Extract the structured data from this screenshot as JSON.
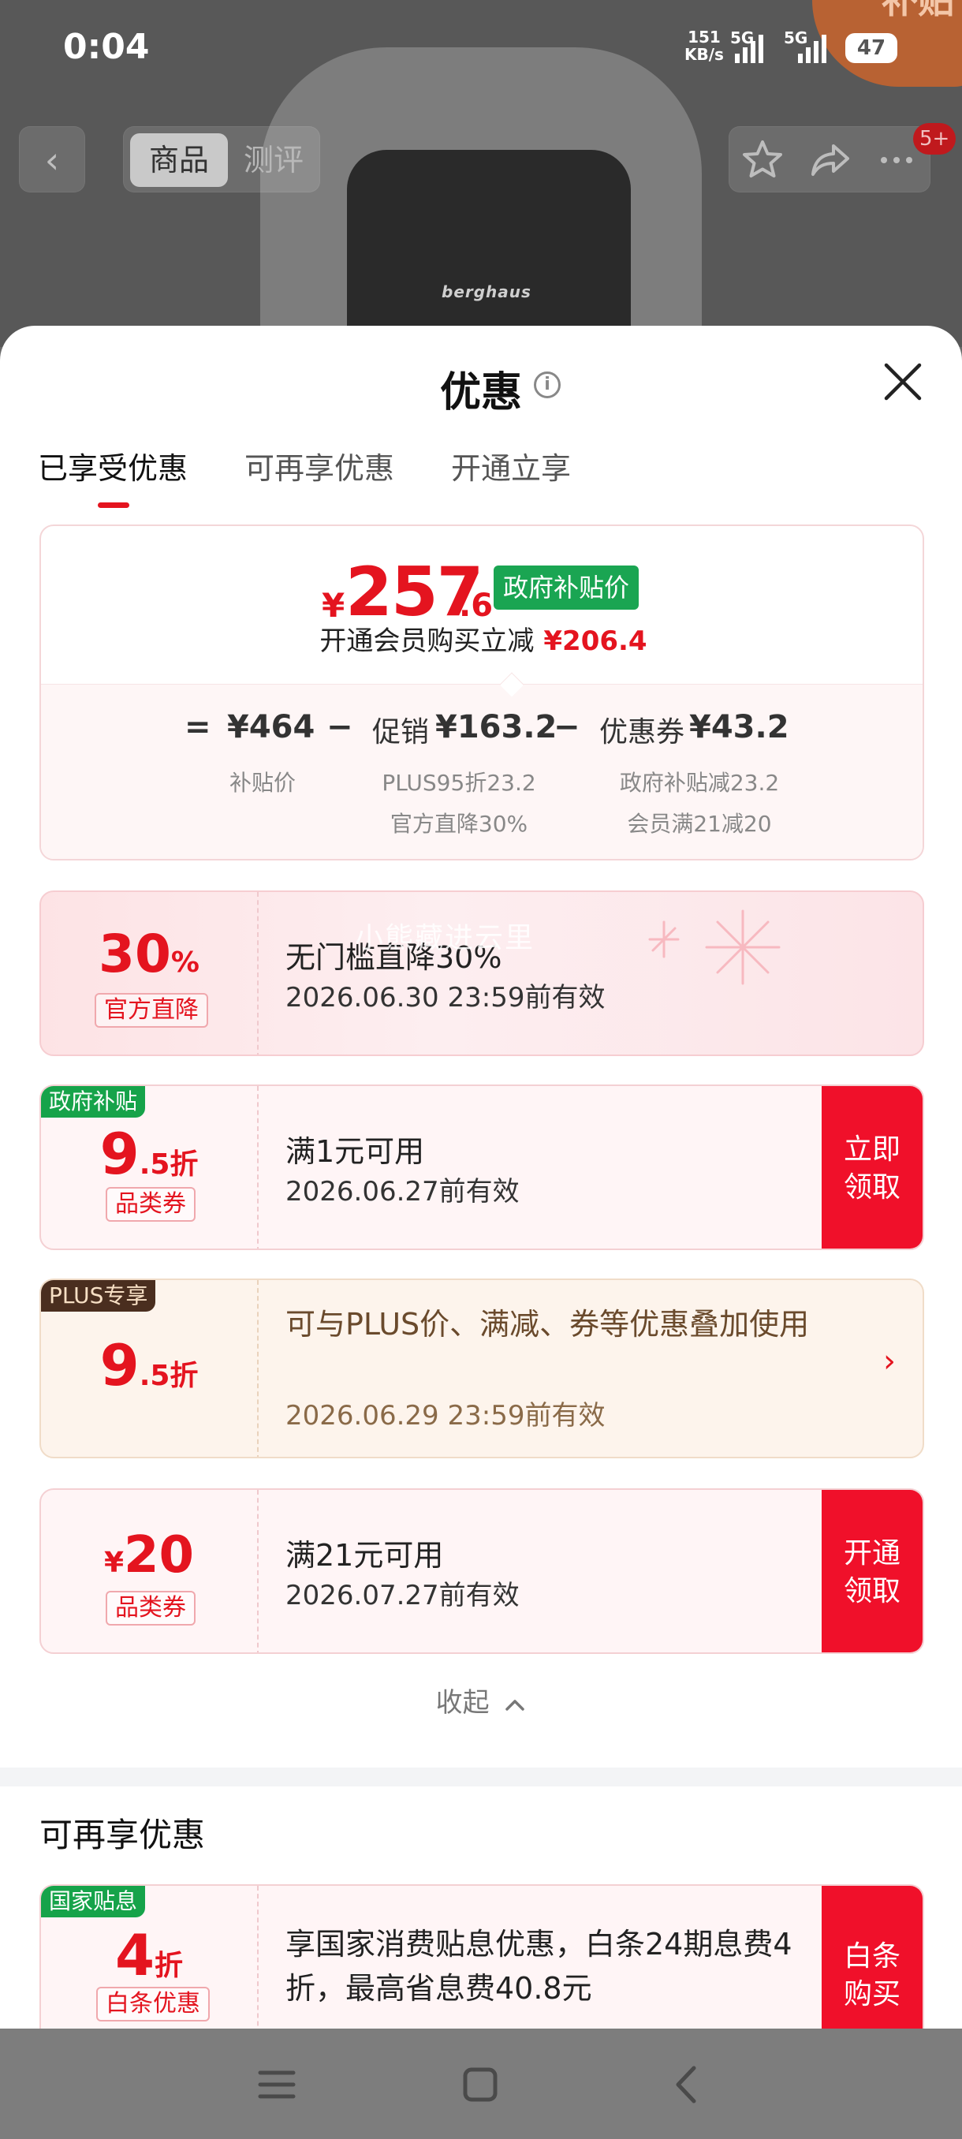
{
  "status_bar": {
    "time": "0:04",
    "speed_value": "151",
    "speed_unit": "KB/s",
    "network1": "5G",
    "network2": "5G",
    "battery": "47"
  },
  "background": {
    "bag_brand": "berghaus",
    "corner_badge": "超级补贴"
  },
  "top_nav": {
    "back_icon": "chevron-left-icon",
    "tab_product": "商品",
    "tab_reviews": "测评",
    "favorite_icon": "star-icon",
    "share_icon": "share-icon",
    "more_icon": "more-icon",
    "badge": "5+"
  },
  "sheet": {
    "title": "优惠",
    "info_icon": "i",
    "tabs": [
      "已享受优惠",
      "可再享优惠",
      "开通立享"
    ],
    "summary": {
      "currency": "¥",
      "price_int": "257",
      "price_dec": ".6",
      "price_tag": "政府补贴价",
      "member_text": "开通会员购买立减",
      "member_amount": "¥206.4",
      "eq": "=",
      "minus": "−",
      "base_price": "¥464",
      "base_label": "补贴价",
      "promo_label": "促销",
      "promo_value": "¥163.2",
      "promo_detail1": "PLUS95折23.2",
      "promo_detail2": "官方直降30%",
      "coupon_label": "优惠券",
      "coupon_value": "¥43.2",
      "coupon_detail1": "政府补贴减23.2",
      "coupon_detail2": "会员满21减20"
    },
    "coupons": [
      {
        "amount": "30",
        "suffix": "%",
        "tag": "官方直降",
        "title": "无门槛直降30%",
        "date": "2026.06.30 23:59前有效"
      },
      {
        "corner": "政府补贴",
        "amount": "9",
        "suffix": ".5折",
        "tag": "品类券",
        "title": "满1元可用",
        "date": "2026.06.27前有效",
        "button": "立即领取"
      },
      {
        "corner": "PLUS专享",
        "amount": "9",
        "suffix": ".5折",
        "title": "可与PLUS价、满减、券等优惠叠加使用",
        "date": "2026.06.29 23:59前有效",
        "arrow": "›"
      },
      {
        "prefix": "¥",
        "amount": "20",
        "tag": "品类券",
        "title": "满21元可用",
        "date": "2026.07.27前有效",
        "button": "开通领取"
      }
    ],
    "watermark": "小熊藏进云里",
    "collapse": "收起",
    "section_title": "可再享优惠",
    "extra_coupon": {
      "corner": "国家贴息",
      "amount": "4",
      "suffix": "折",
      "tag": "白条优惠",
      "title": "享国家消费贴息优惠，白条24期息费4折，最高省息费40.8元",
      "button": "白条购买"
    }
  },
  "system_nav": {
    "menu_icon": "menu-icon",
    "home_icon": "home-icon",
    "back_icon": "back-icon"
  },
  "colors": {
    "accent_red": "#e4141f",
    "gov_green": "#1aa552",
    "plus_brown": "#4a2e1f"
  }
}
